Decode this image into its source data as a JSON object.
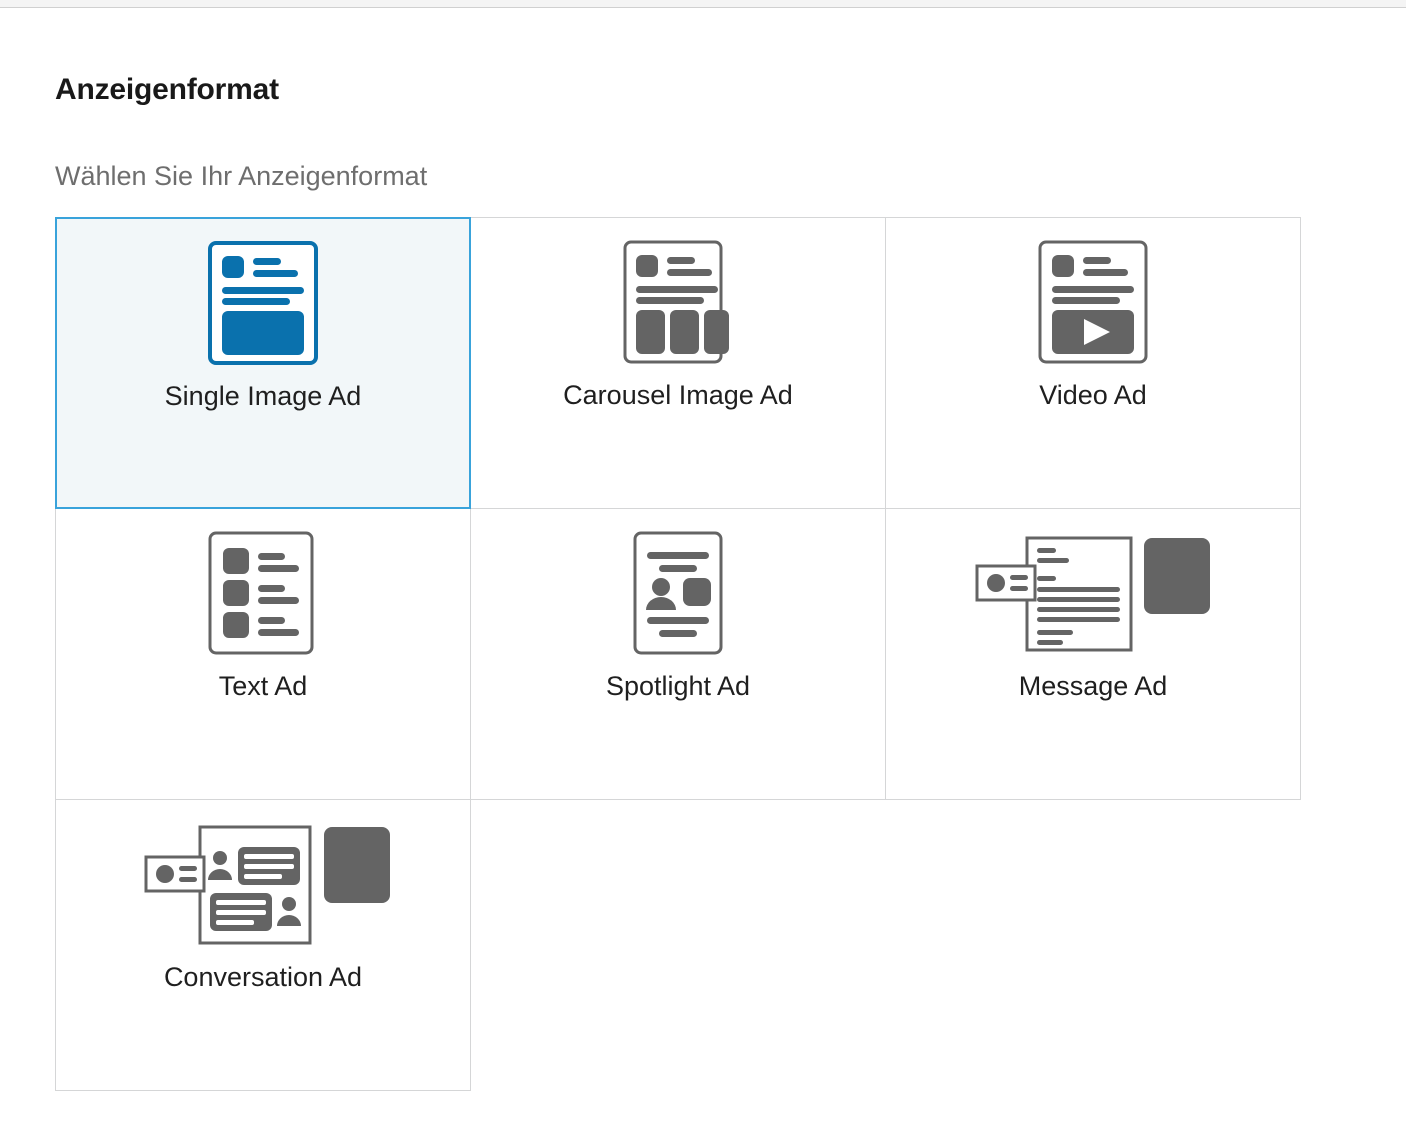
{
  "page": {
    "title": "Anzeigenformat",
    "subtitle": "Wählen Sie Ihr Anzeigenformat"
  },
  "colors": {
    "selected_border": "#39a3db",
    "selected_fill": "#f2f7f9",
    "card_border": "#d5d6d7",
    "icon_grey": "#646464",
    "icon_blue": "#0a71ad",
    "title_text": "#191919",
    "subtitle_text": "#6e6e6e",
    "label_text": "#1f1f1f"
  },
  "format_grid": {
    "selected_index": 0,
    "cards": [
      {
        "label": "Single Image Ad",
        "icon": "single-image-ad-icon",
        "selected": true
      },
      {
        "label": "Carousel Image Ad",
        "icon": "carousel-image-ad-icon",
        "selected": false
      },
      {
        "label": "Video Ad",
        "icon": "video-ad-icon",
        "selected": false
      },
      {
        "label": "Text Ad",
        "icon": "text-ad-icon",
        "selected": false
      },
      {
        "label": "Spotlight Ad",
        "icon": "spotlight-ad-icon",
        "selected": false
      },
      {
        "label": "Message Ad",
        "icon": "message-ad-icon",
        "selected": false
      },
      {
        "label": "Conversation Ad",
        "icon": "conversation-ad-icon",
        "selected": false
      }
    ]
  }
}
